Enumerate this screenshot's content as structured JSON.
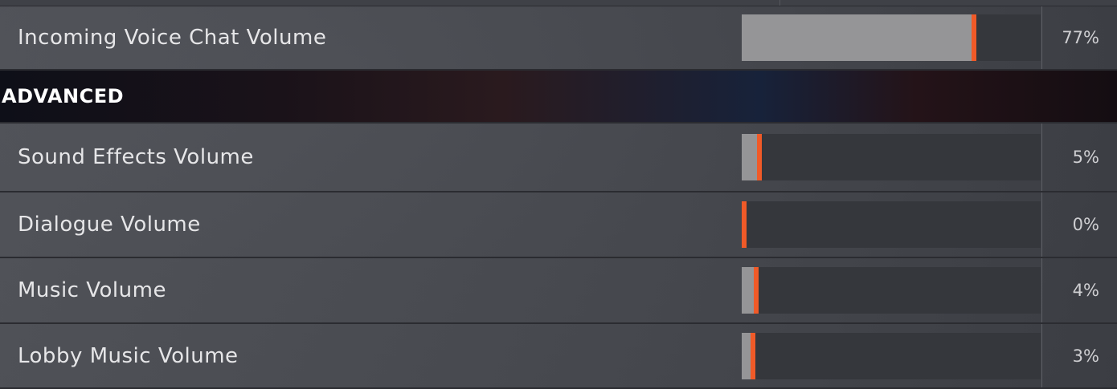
{
  "rows_top": [
    {
      "label": "Incoming Voice Chat Volume",
      "value_text": "77%",
      "level": 0.77
    }
  ],
  "section": {
    "title": "ADVANCED"
  },
  "rows": [
    {
      "label": "Sound Effects Volume",
      "value_text": "5%",
      "level": 0.05
    },
    {
      "label": "Dialogue Volume",
      "value_text": "0%",
      "level": 0.0
    },
    {
      "label": "Music Volume",
      "value_text": "4%",
      "level": 0.04
    },
    {
      "label": "Lobby Music Volume",
      "value_text": "3%",
      "level": 0.03
    }
  ],
  "colors": {
    "accent": "#f05a28",
    "fill": "#959597",
    "track": "#35373c"
  }
}
